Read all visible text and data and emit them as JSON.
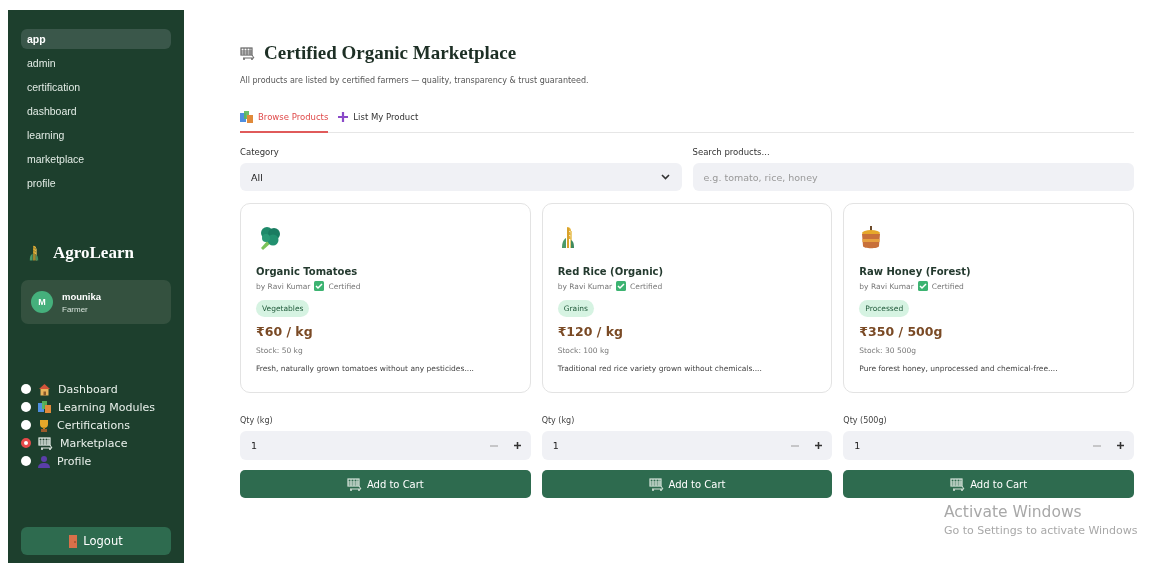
{
  "sidebar": {
    "nav_items": [
      {
        "label": "app",
        "selected": true
      },
      {
        "label": "admin",
        "selected": false
      },
      {
        "label": "certification",
        "selected": false
      },
      {
        "label": "dashboard",
        "selected": false
      },
      {
        "label": "learning",
        "selected": false
      },
      {
        "label": "marketplace",
        "selected": false
      },
      {
        "label": "profile",
        "selected": false
      }
    ],
    "brand": "AgroLearn",
    "user": {
      "initial": "M",
      "name": "mounika",
      "role": "Farmer"
    },
    "menu": [
      {
        "label": "Dashboard",
        "selected": false
      },
      {
        "label": "Learning Modules",
        "selected": false
      },
      {
        "label": "Certifications",
        "selected": false
      },
      {
        "label": "Marketplace",
        "selected": true
      },
      {
        "label": "Profile",
        "selected": false
      }
    ],
    "logout": "Logout"
  },
  "main": {
    "title": "Certified Organic Marketplace",
    "subtitle": "All products are listed by certified farmers — quality, transparency & trust guaranteed.",
    "tabs": [
      {
        "label": "Browse Products",
        "selected": true
      },
      {
        "label": "List My Product",
        "selected": false
      }
    ],
    "category": {
      "label": "Category",
      "value": "All"
    },
    "search": {
      "label": "Search products...",
      "placeholder": "e.g. tomato, rice, honey"
    },
    "products": [
      {
        "name": "Organic Tomatoes",
        "seller": "by Ravi Kumar",
        "certified": "Certified",
        "category": "Vegetables",
        "price": "₹60 / kg",
        "stock": "Stock: 50 kg",
        "description": "Fresh, naturally grown tomatoes without any pesticides....",
        "qty_label": "Qty (kg)",
        "qty": "1",
        "button": "Add to Cart"
      },
      {
        "name": "Red Rice (Organic)",
        "seller": "by Ravi Kumar",
        "certified": "Certified",
        "category": "Grains",
        "price": "₹120 / kg",
        "stock": "Stock: 100 kg",
        "description": "Traditional red rice variety grown without chemicals....",
        "qty_label": "Qty (kg)",
        "qty": "1",
        "button": "Add to Cart"
      },
      {
        "name": "Raw Honey (Forest)",
        "seller": "by Ravi Kumar",
        "certified": "Certified",
        "category": "Processed",
        "price": "₹350 / 500g",
        "stock": "Stock: 30 500g",
        "description": "Pure forest honey, unprocessed and chemical-free....",
        "qty_label": "Qty (500g)",
        "qty": "1",
        "button": "Add to Cart"
      }
    ]
  },
  "os_notice": {
    "title": "Activate Windows",
    "text": "Go to Settings to activate Windows"
  }
}
